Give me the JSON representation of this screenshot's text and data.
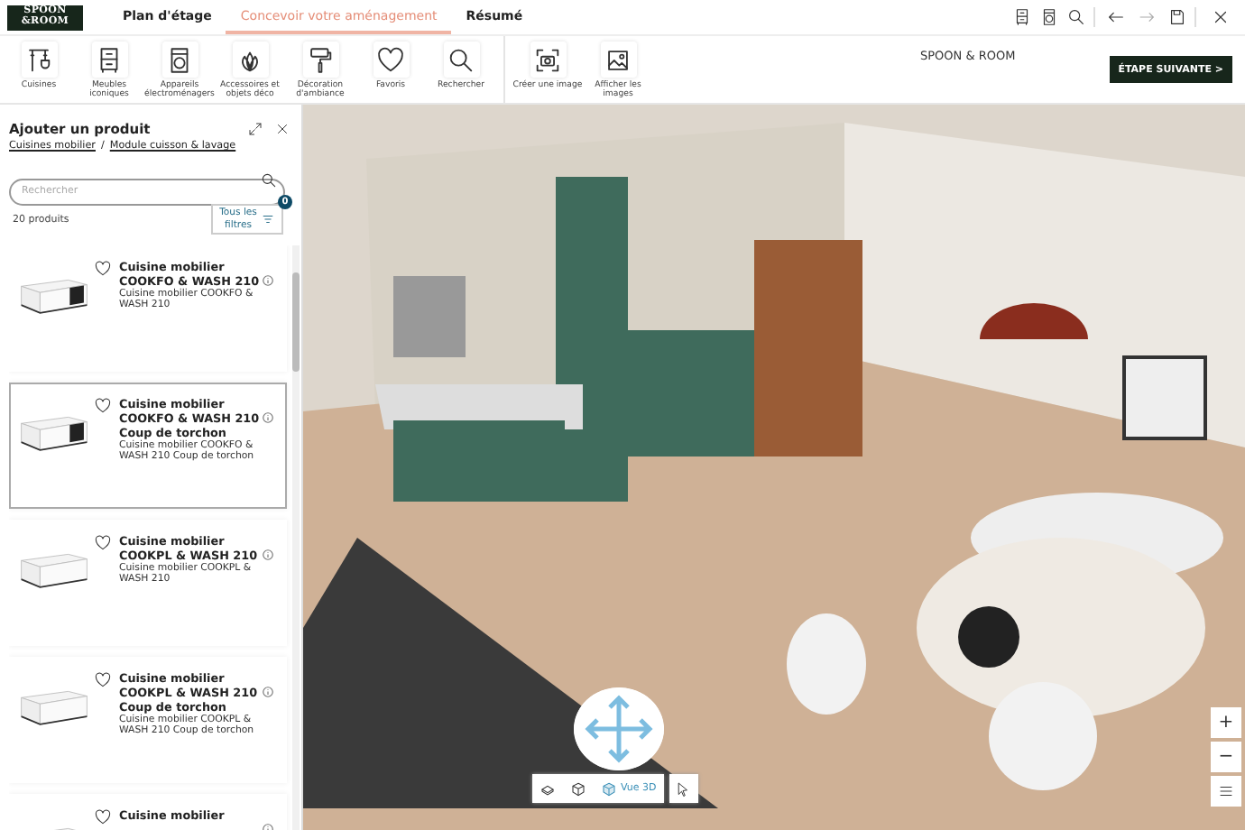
{
  "logo": {
    "line_1": "SPOON",
    "line_2": "&ROOM"
  },
  "nav_tabs": [
    {
      "label": "Plan d'étage",
      "selected": false
    },
    {
      "label": "Concevoir votre aménagement",
      "selected": true
    },
    {
      "label": "Résumé",
      "selected": false
    }
  ],
  "tools": [
    {
      "kind": "kitchen",
      "label": "Cuisines"
    },
    {
      "kind": "cabinet",
      "label": "Meubles iconiques"
    },
    {
      "kind": "appliance",
      "label": "Appareils électroménagers"
    },
    {
      "kind": "plant",
      "label": "Accessoires et objets déco"
    },
    {
      "kind": "roller",
      "label": "Décoration d'ambiance"
    },
    {
      "kind": "heart",
      "label": "Favoris"
    },
    {
      "kind": "search",
      "label": "Rechercher"
    }
  ],
  "image_tools": [
    {
      "kind": "camera",
      "label": "Créer une image"
    },
    {
      "kind": "picture",
      "label": "Afficher les images"
    }
  ],
  "brand": "SPOON & ROOM",
  "next_button": "ÉTAPE SUIVANTE >",
  "panel": {
    "title": "Ajouter un produit",
    "breadcrumb": [
      "Cuisines mobilier",
      "Module cuisson & lavage"
    ],
    "separator": "/",
    "search": {
      "placeholder": "Rechercher"
    },
    "count": "20 produits",
    "filter_button": "Tous les filtres",
    "filter_badge": "0",
    "products": [
      {
        "name": "Cuisine mobilier COOKFO & WASH 210",
        "description": "Cuisine mobilier COOKFO & WASH 210",
        "selected": false,
        "oven": true
      },
      {
        "name": "Cuisine mobilier COOKFO & WASH 210 Coup de torchon",
        "description": "Cuisine mobilier COOKFO & WASH 210 Coup de torchon",
        "selected": true,
        "oven": true
      },
      {
        "name": "Cuisine mobilier COOKPL & WASH 210",
        "description": "Cuisine mobilier COOKPL & WASH 210",
        "selected": false,
        "oven": false
      },
      {
        "name": "Cuisine mobilier COOKPL & WASH 210 Coup de torchon",
        "description": "Cuisine mobilier COOKPL & WASH 210 Coup de torchon",
        "selected": false,
        "oven": false
      },
      {
        "name": "Cuisine mobilier",
        "selected": false,
        "oven": false
      }
    ]
  },
  "view_modes": [
    {
      "kind": "plane",
      "selected": false
    },
    {
      "kind": "box",
      "selected": false
    },
    {
      "kind": "cube",
      "label": "Vue 3D",
      "selected": true
    }
  ],
  "zoom": {
    "in": "+",
    "out": "−"
  }
}
